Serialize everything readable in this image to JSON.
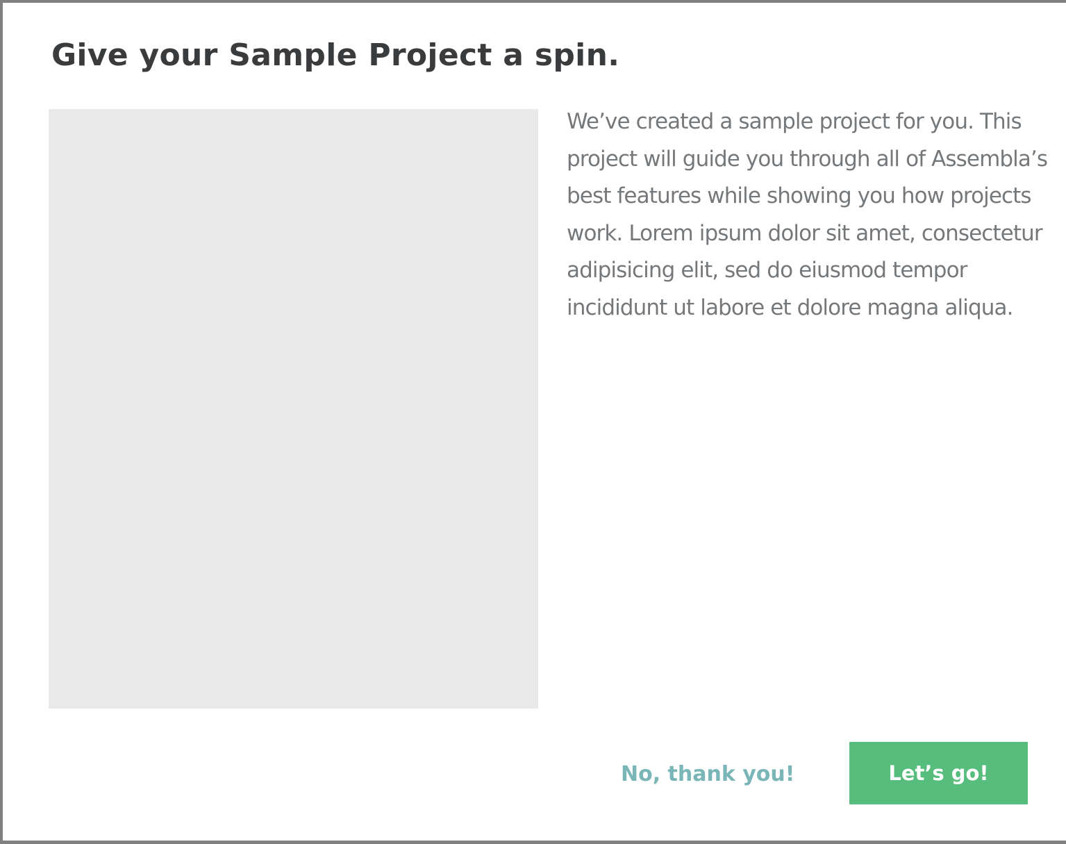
{
  "modal": {
    "title": "Give your Sample Project a spin.",
    "description": "We’ve created a sample project for you. This project will guide you through all of Assembla’s best features while showing you how projects work. Lorem ipsum dolor sit amet, consectetur adipisicing elit, sed do eiusmod tempor incididunt ut labore et dolore magna aliqua.",
    "decline_label": "No, thank you!",
    "accept_label": "Let’s go!"
  },
  "colors": {
    "title": "#3a3b3d",
    "body_text": "#75787b",
    "media_placeholder": "#e9e9e9",
    "accept_button": "#57bd7c",
    "decline_link": "#7ab6b8",
    "overlay": "#808080"
  }
}
